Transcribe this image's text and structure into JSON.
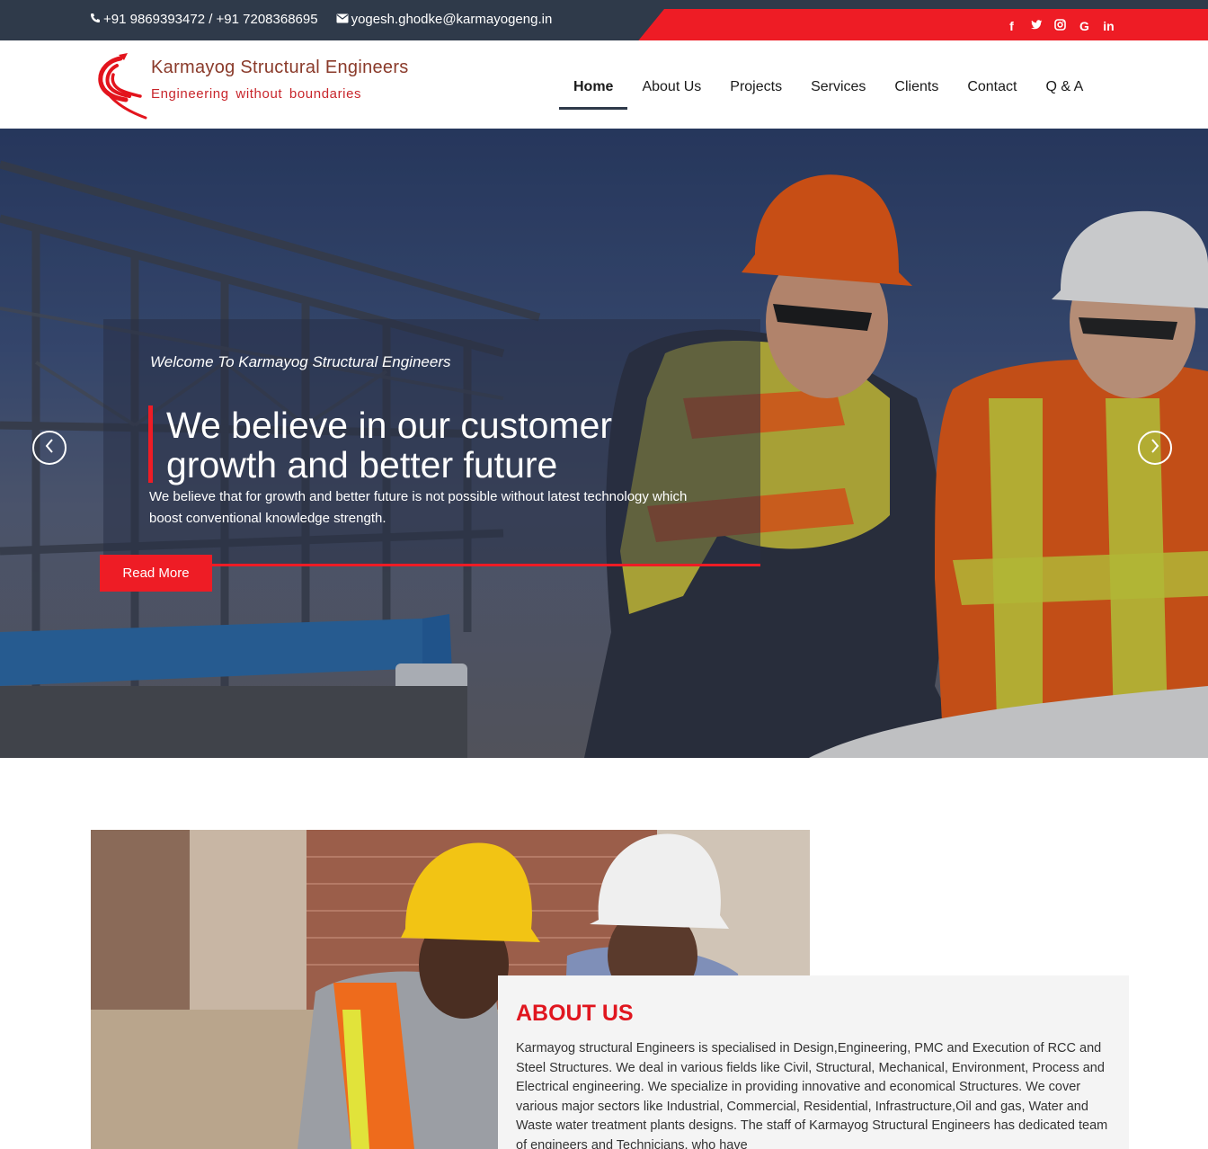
{
  "topbar": {
    "phone": "+91 9869393472 / +91 7208368695",
    "email": "yogesh.ghodke@karmayogeng.in",
    "phone_icon": "phone-icon",
    "email_icon": "envelope-icon",
    "social": [
      {
        "name": "facebook-icon",
        "glyph": "f"
      },
      {
        "name": "twitter-icon",
        "glyph": "t"
      },
      {
        "name": "instagram-icon",
        "glyph": "◎"
      },
      {
        "name": "google-icon",
        "glyph": "G"
      },
      {
        "name": "linkedin-icon",
        "glyph": "in"
      }
    ]
  },
  "brand": {
    "name": "Karmayog Structural Engineers",
    "tagline": "Engineering without boundaries"
  },
  "nav": {
    "home": "Home",
    "about": "About Us",
    "projects": "Projects",
    "services": "Services",
    "clients": "Clients",
    "contact": "Contact",
    "qa": "Q & A"
  },
  "hero": {
    "welcome": "Welcome To Karmayog Structural Engineers",
    "title_line1": "We believe in our customer",
    "title_line2": "growth and better future",
    "description": "We believe that for growth and better future is not possible without latest technology which boost conventional knowledge strength.",
    "button": "Read More",
    "prev_icon": "chevron-left-icon",
    "next_icon": "chevron-right-icon"
  },
  "about": {
    "title": "ABOUT US",
    "text": "Karmayog structural Engineers is specialised in Design,Engineering, PMC and Execution of RCC and Steel Structures. We deal in various fields like Civil, Structural, Mechanical, Environment, Process and Electrical engineering. We specialize in providing innovative and economical Structures. We cover various major sectors like Industrial, Commercial, Residential, Infrastructure,Oil and gas, Water and Waste water treatment plants designs. The staff of Karmayog Structural Engineers has dedicated team of engineers and Technicians, who have"
  },
  "colors": {
    "accent_red": "#ee1c25",
    "topbar_navy": "#2f3a4a",
    "about_title_red": "#e0161f"
  }
}
